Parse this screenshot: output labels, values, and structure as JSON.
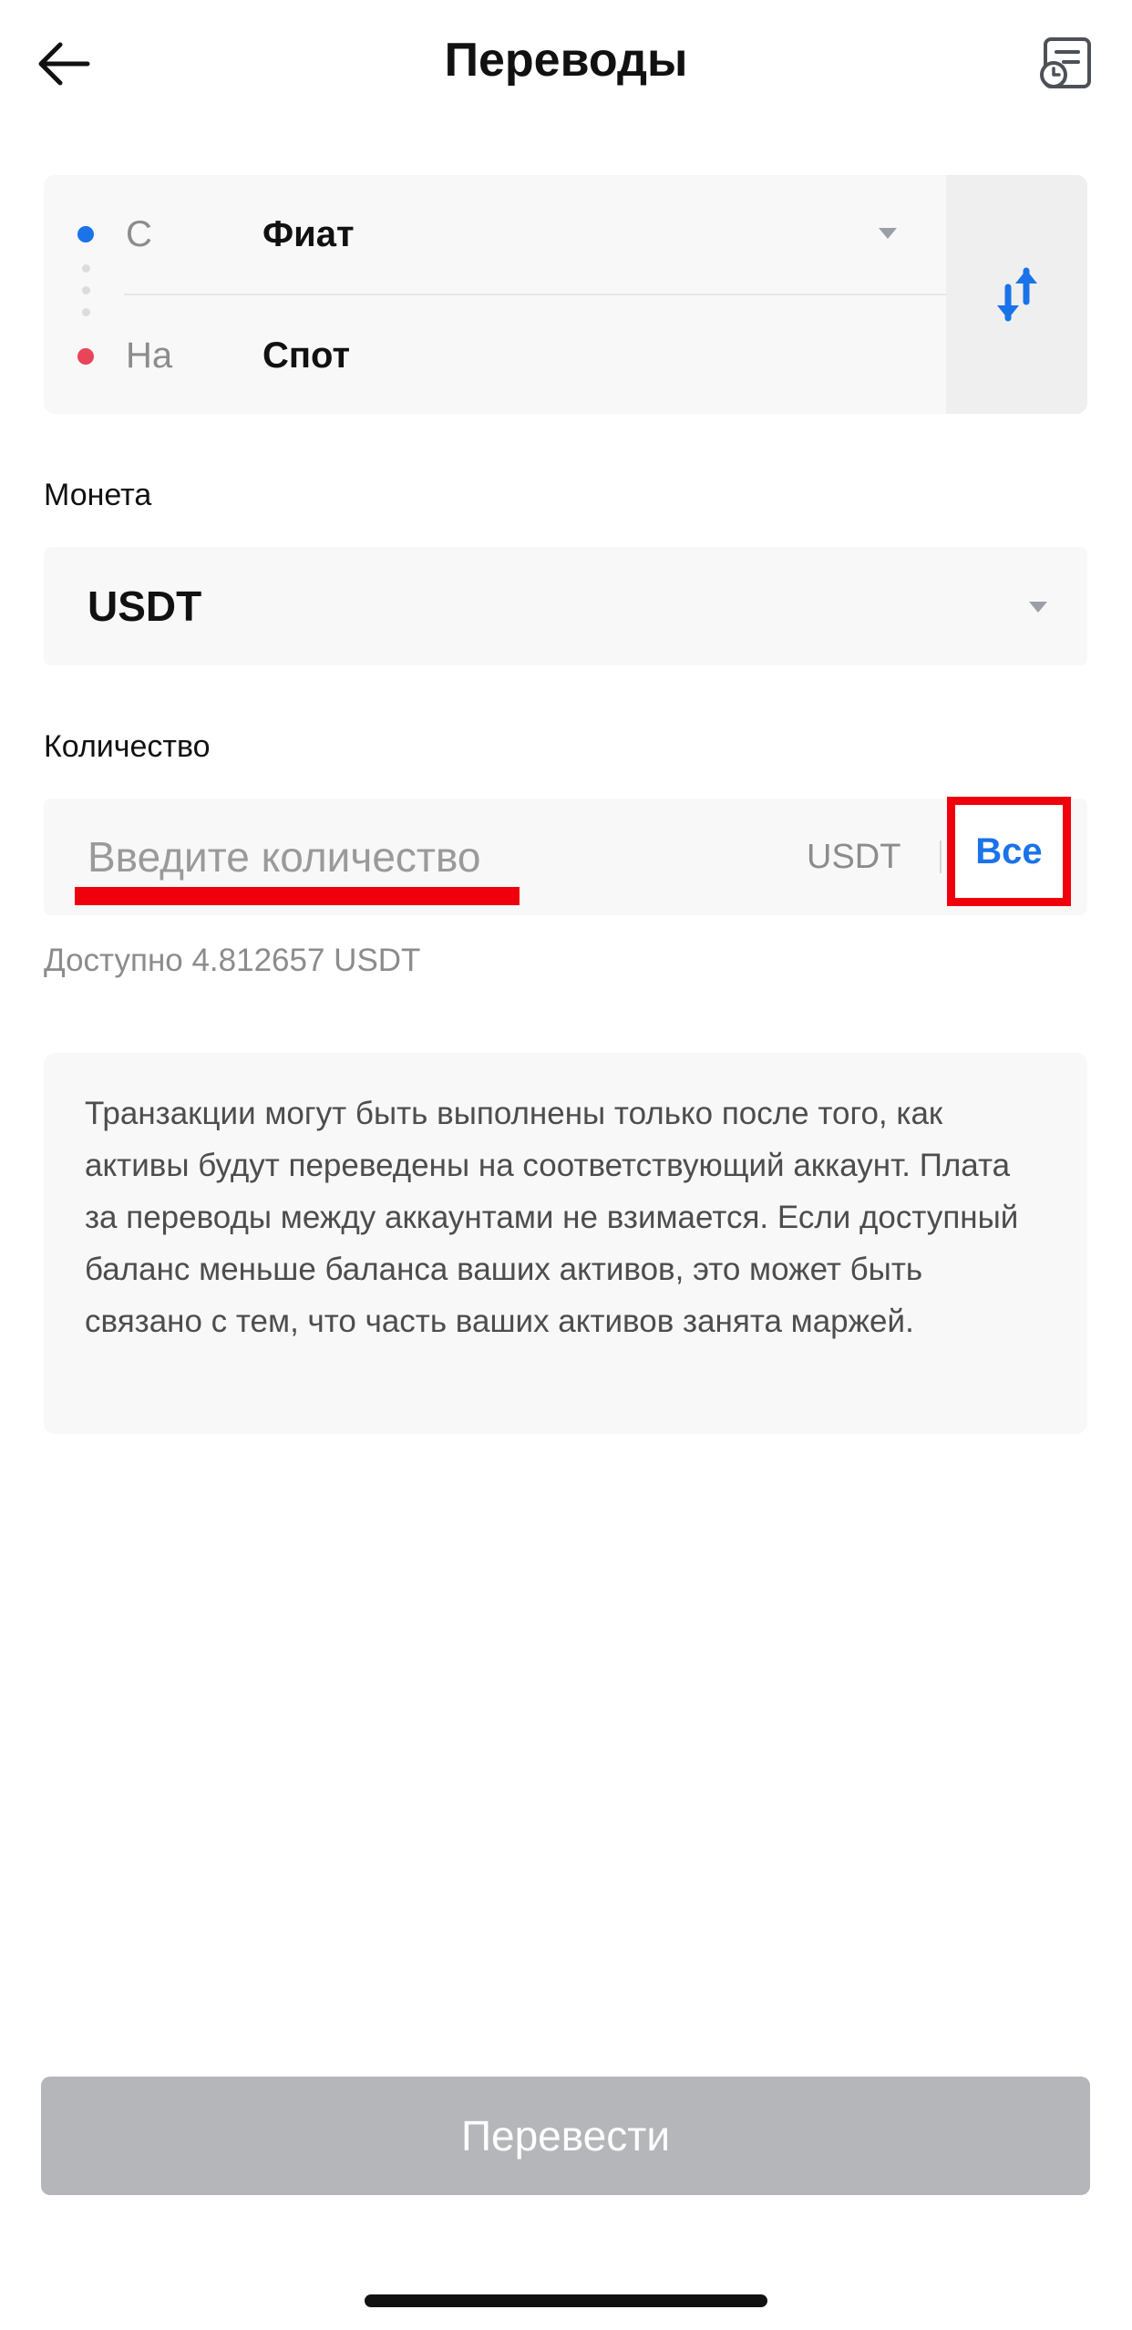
{
  "header": {
    "title": "Переводы"
  },
  "transfer": {
    "from_label": "С",
    "from_value": "Фиат",
    "to_label": "На",
    "to_value": "Спот"
  },
  "coin": {
    "label": "Монета",
    "value": "USDT"
  },
  "amount": {
    "label": "Количество",
    "placeholder": "Введите количество",
    "unit": "USDT",
    "all_label": "Все",
    "available": "Доступно 4.812657 USDT"
  },
  "notice": {
    "text": "Транзакции могут быть выполнены только после того, как активы будут переведены на соответствующий аккаунт. Плата за переводы между аккаунтами не взимается. Если доступный баланс меньше баланса ваших активов, это может быть связано с тем, что часть ваших активов занята маржей."
  },
  "submit": {
    "label": "Перевести"
  },
  "colors": {
    "accent": "#1a73e8",
    "from_dot": "#1a73e8",
    "to_dot": "#e8445a",
    "disabled_button": "#b4b6b9",
    "highlight": "#f0000c"
  },
  "icons": {
    "back": "arrow-left-icon",
    "history": "transfer-history-icon",
    "swap": "swap-arrows-icon",
    "dropdown": "caret-down-icon"
  }
}
